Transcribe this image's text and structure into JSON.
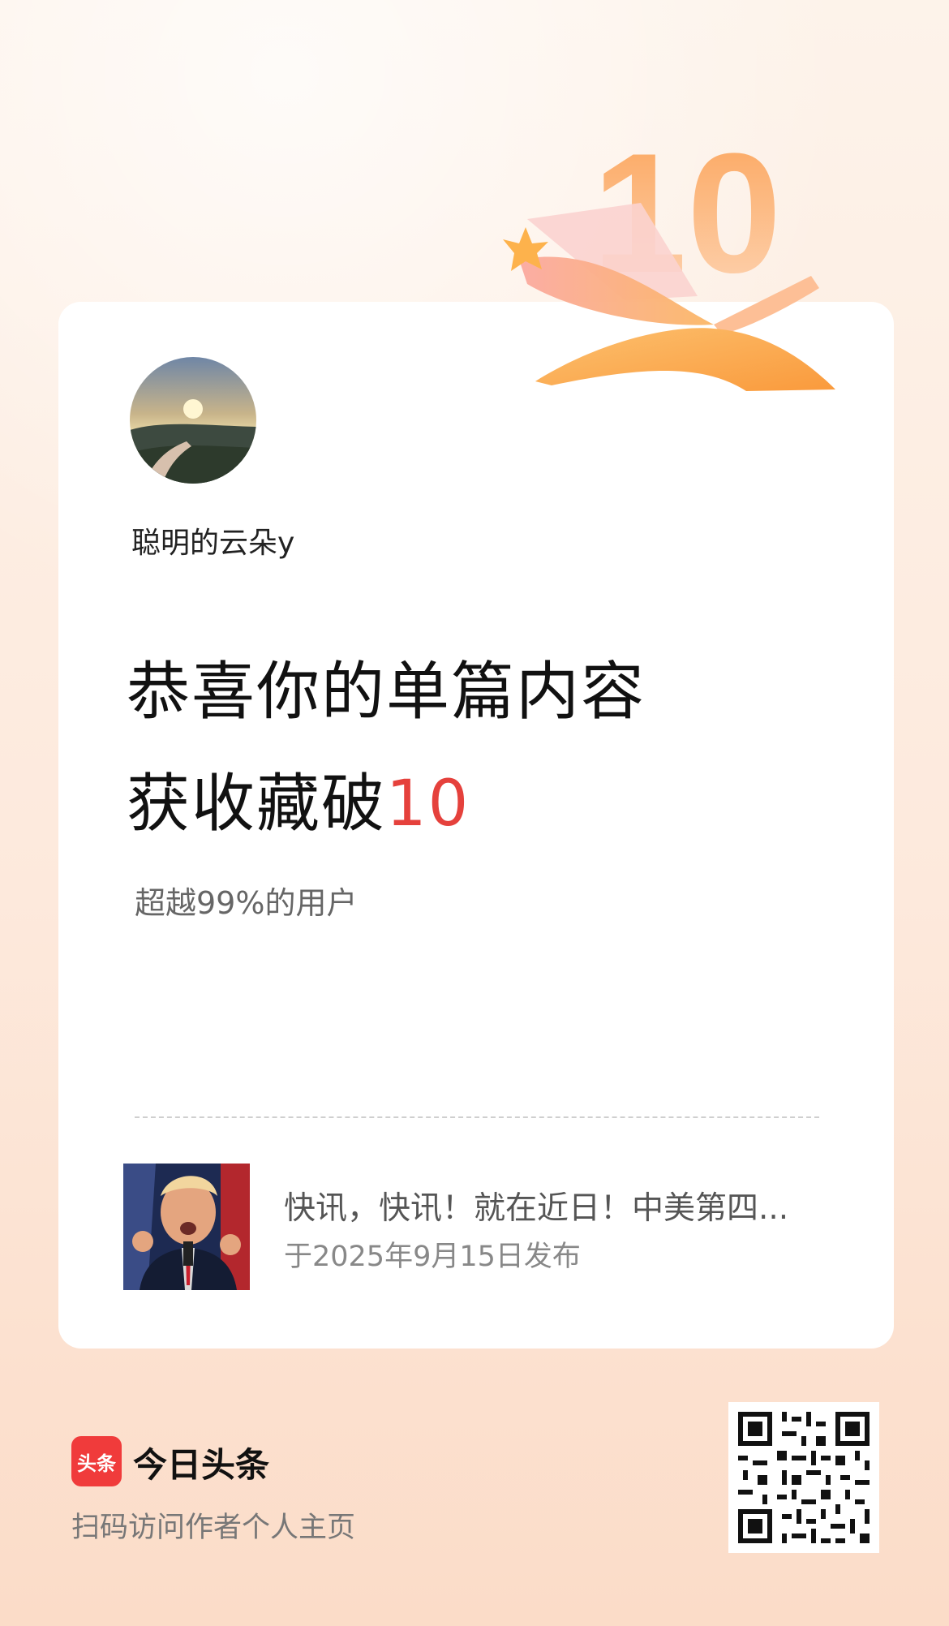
{
  "author": {
    "name": "聪明的云朵y"
  },
  "headline": {
    "line1": "恭喜你的单篇内容",
    "line2_prefix": "获收藏破",
    "number": "10"
  },
  "badge": {
    "number": "10"
  },
  "subtitle": "超越99%的用户",
  "article": {
    "title": "快讯，快讯！就在近日！中美第四...",
    "date": "于2025年9月15日发布"
  },
  "footer": {
    "logo_text": "头条",
    "brand": "今日头条",
    "caption": "扫码访问作者个人主页"
  },
  "colors": {
    "accent": "#e5413c",
    "brand_red": "#f03b3b",
    "badge_orange": "#fb8b3a"
  },
  "icons": [
    "collection-milestone-badge-icon",
    "qr-code-icon"
  ]
}
